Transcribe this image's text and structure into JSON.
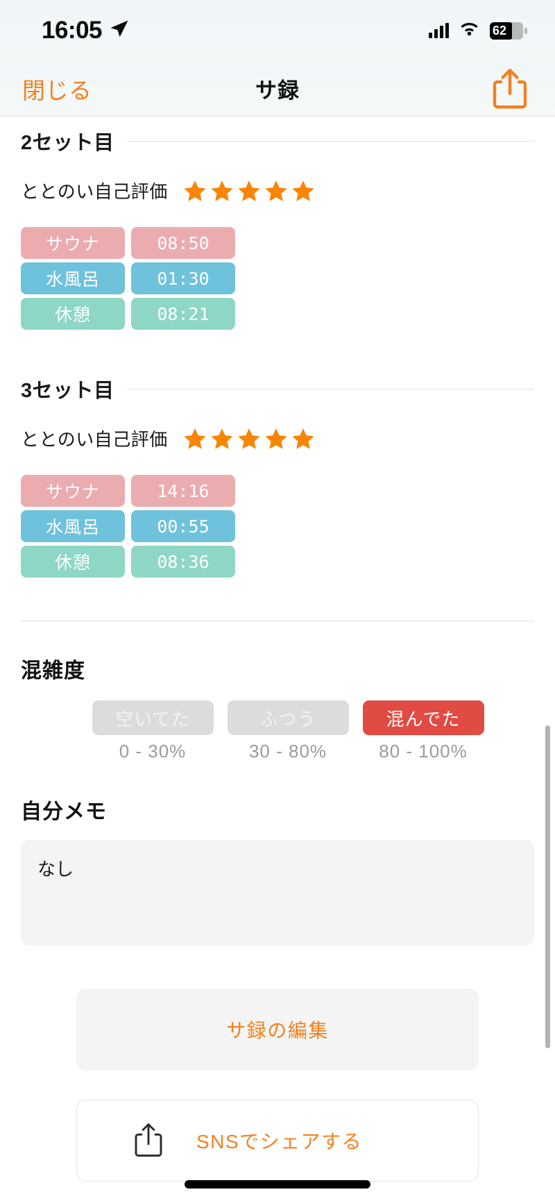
{
  "status_bar": {
    "time": "16:05",
    "location_icon": "location-arrow-icon",
    "signal_icon": "cellular-signal-icon",
    "wifi_icon": "wifi-icon",
    "battery_percent": "62"
  },
  "nav": {
    "close_label": "閉じる",
    "title": "サ録",
    "share_icon": "share-icon"
  },
  "sets": [
    {
      "title": "2セット目",
      "rating_label": "ととのい自己評価",
      "rating": 5,
      "rows": [
        {
          "name": "サウナ",
          "time": "08:50",
          "color": "#EBACB0"
        },
        {
          "name": "水風呂",
          "time": "01:30",
          "color": "#6FC2DC"
        },
        {
          "name": "休憩",
          "time": "08:21",
          "color": "#8ED7C7"
        }
      ]
    },
    {
      "title": "3セット目",
      "rating_label": "ととのい自己評価",
      "rating": 5,
      "rows": [
        {
          "name": "サウナ",
          "time": "14:16",
          "color": "#EBACB0"
        },
        {
          "name": "水風呂",
          "time": "00:55",
          "color": "#6FC2DC"
        },
        {
          "name": "休憩",
          "time": "08:36",
          "color": "#8ED7C7"
        }
      ]
    }
  ],
  "congestion": {
    "title": "混雑度",
    "options": [
      {
        "label": "空いてた",
        "range": "0 - 30%",
        "selected": false
      },
      {
        "label": "ふつう",
        "range": "30 - 80%",
        "selected": false
      },
      {
        "label": "混んでた",
        "range": "80 - 100%",
        "selected": true
      }
    ],
    "selected_color": "#E04B43",
    "unselected_color": "#dcdcdc"
  },
  "memo": {
    "title": "自分メモ",
    "value": "なし"
  },
  "actions": {
    "edit_label": "サ録の編集",
    "share_label": "SNSでシェアする",
    "share_icon": "share-icon",
    "accent_color": "#F4811F"
  }
}
